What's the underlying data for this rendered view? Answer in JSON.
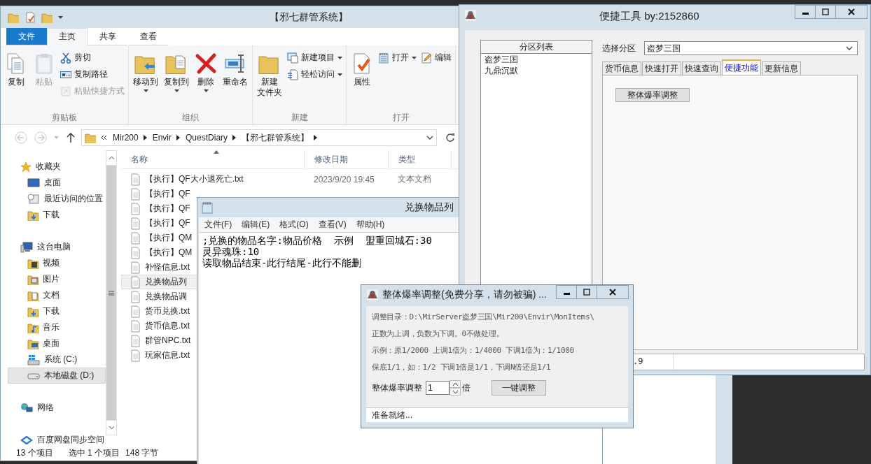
{
  "explorer": {
    "title": "【邪七群管系统】",
    "ribbon_tabs": [
      {
        "label": "文件",
        "kind": "menu",
        "selected": false
      },
      {
        "label": "主页",
        "kind": "tab",
        "selected": true
      },
      {
        "label": "共享",
        "kind": "tab",
        "selected": false
      },
      {
        "label": "查看",
        "kind": "tab",
        "selected": false
      }
    ],
    "ribbon_groups": [
      {
        "label": "剪贴板",
        "large": [
          {
            "label": "复制",
            "disabled": false,
            "has_menu": false
          },
          {
            "label": "粘贴",
            "disabled": true,
            "has_menu": false
          }
        ],
        "small": [
          {
            "label": "剪切",
            "disabled": false,
            "has_menu": false
          },
          {
            "label": "复制路径",
            "disabled": false,
            "has_menu": false
          },
          {
            "label": "粘贴快捷方式",
            "disabled": true,
            "has_menu": false
          }
        ]
      },
      {
        "label": "组织",
        "large": [
          {
            "label": "移动到",
            "disabled": false,
            "has_menu": true
          },
          {
            "label": "复制到",
            "disabled": false,
            "has_menu": true
          },
          {
            "label": "删除",
            "disabled": false,
            "has_menu": true
          },
          {
            "label": "重命名",
            "disabled": false,
            "has_menu": false
          }
        ]
      },
      {
        "label": "新建",
        "large": [
          {
            "label": "新建",
            "label_line_2": "文件夹",
            "disabled": false,
            "has_menu": false
          }
        ],
        "small": [
          {
            "label": "新建项目",
            "disabled": false,
            "has_menu": true
          },
          {
            "label": "轻松访问",
            "disabled": false,
            "has_menu": true
          }
        ]
      },
      {
        "label": "打开",
        "large": [
          {
            "label": "属性",
            "disabled": false,
            "has_menu": false
          }
        ],
        "small": [
          {
            "label": "打开",
            "disabled": false,
            "has_menu": true
          }
        ],
        "extra": [
          {
            "label": "编辑",
            "disabled": false,
            "has_menu": false
          }
        ]
      }
    ],
    "address": {
      "path": [
        "Mir200",
        "Envir",
        "QuestDiary",
        "【邪七群管系统】"
      ]
    },
    "nav": [
      {
        "label": "收藏夹",
        "selected": false,
        "children": [
          {
            "label": "桌面",
            "selected": false
          },
          {
            "label": "最近访问的位置",
            "selected": false
          },
          {
            "label": "下载",
            "selected": false
          }
        ]
      },
      {
        "label": "这台电脑",
        "selected": false,
        "children": [
          {
            "label": "视频",
            "selected": false
          },
          {
            "label": "图片",
            "selected": false
          },
          {
            "label": "文档",
            "selected": false
          },
          {
            "label": "下载",
            "selected": false
          },
          {
            "label": "音乐",
            "selected": false
          },
          {
            "label": "桌面",
            "selected": false
          },
          {
            "label": "系统 (C:)",
            "selected": false
          },
          {
            "label": "本地磁盘 (D:)",
            "selected": true
          }
        ]
      },
      {
        "label": "网络",
        "selected": false
      },
      {
        "label": "百度网盘同步空间",
        "selected": false
      }
    ],
    "columns": [
      "名称",
      "修改日期",
      "类型"
    ],
    "files": [
      {
        "name": "【执行】QF大小退死亡.txt",
        "modified": "2023/9/20 19:45",
        "type": "文本文档",
        "selected": false
      },
      {
        "name": "【执行】QF",
        "selected": false
      },
      {
        "name": "【执行】QF",
        "selected": false
      },
      {
        "name": "【执行】QF",
        "selected": false
      },
      {
        "name": "【执行】QM",
        "selected": false
      },
      {
        "name": "【执行】QM",
        "selected": false
      },
      {
        "name": "补怪信息.txt",
        "selected": false
      },
      {
        "name": "兑换物品列",
        "selected": true
      },
      {
        "name": "兑换物品调",
        "selected": false
      },
      {
        "name": "货币兑换.txt",
        "selected": false
      },
      {
        "name": "货币信息.txt",
        "selected": false
      },
      {
        "name": "群管NPC.txt",
        "selected": false
      },
      {
        "name": "玩家信息.txt",
        "selected": false
      }
    ],
    "status": [
      "13 个项目",
      "选中 1 个项目",
      "148 字节"
    ]
  },
  "notepad": {
    "title": "兑换物品列",
    "menu": [
      "文件(F)",
      "编辑(E)",
      "格式(O)",
      "查看(V)",
      "帮助(H)"
    ],
    "lines": [
      ";兑换的物品名字:物品价格  示例  盟重回城石:30",
      "灵异魂珠:10",
      "读取物品结束-此行结尾-此行不能删"
    ]
  },
  "tool": {
    "title": "便捷工具 by:2152860",
    "list_header": "分区列表",
    "partitions": [
      {
        "label": "盗梦三国",
        "selected": false
      },
      {
        "label": "九鼎沉默",
        "selected": false
      }
    ],
    "partition_select": {
      "label": "选择分区",
      "value": "盗梦三国"
    },
    "tabs": [
      {
        "label": "货币信息",
        "selected": false
      },
      {
        "label": "快速打开",
        "selected": false
      },
      {
        "label": "快速查询",
        "selected": false
      },
      {
        "label": "便捷功能",
        "selected": true
      },
      {
        "label": "更新信息",
        "selected": false
      }
    ],
    "panel_button": "整体爆率调整",
    "status": [
      ".9"
    ]
  },
  "dialog": {
    "title": "整体爆率调整(免费分享，请勿被骗) ...",
    "notes": [
      "调整目录：D:\\MirServer盗梦三国\\Mir200\\Envir\\MonItems\\",
      "正数为上调，负数为下调。0不做处理。",
      "示例：原1/2000 上调1倍为：1/4000 下调1倍为：1/1000",
      "保底1/1，如：1/2 下调1倍是1/1，下调N倍还是1/1"
    ],
    "field_label": "整体爆率调整",
    "value": "1",
    "unit": "倍",
    "button": "一键调整",
    "status": "准备就绪..."
  }
}
